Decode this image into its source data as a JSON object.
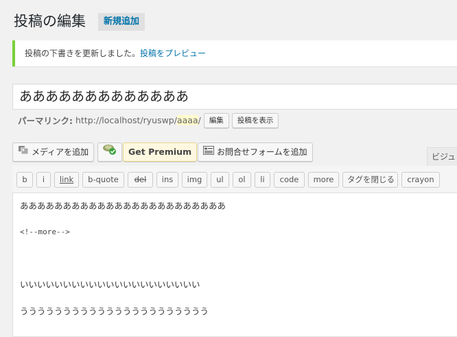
{
  "header": {
    "title": "投稿の編集",
    "add_new_label": "新規追加"
  },
  "notice": {
    "text": "投稿の下書きを更新しました。",
    "link_text": "投稿をプレビュー",
    "accent_color": "#7ad03a"
  },
  "post": {
    "title": "あああああああああああああ"
  },
  "permalink": {
    "label": "パーマリンク:",
    "url_prefix": "http://localhost/ryuswp/",
    "slug": "aaaa",
    "url_suffix": "/",
    "edit_label": "編集",
    "view_label": "投稿を表示"
  },
  "media_buttons": {
    "add_media_label": "メディアを追加",
    "get_premium_label": "Get Premium",
    "add_form_label": "お問合せフォームを追加"
  },
  "editor": {
    "visual_tab_label": "ビジュ",
    "quicktags": [
      "b",
      "i",
      "link",
      "b-quote",
      "del",
      "ins",
      "img",
      "ul",
      "ol",
      "li",
      "code",
      "more",
      "タグを閉じる",
      "crayon"
    ],
    "lines": [
      "ああああああああああああああああああああああああ",
      "<!--more-->",
      "いいいいいいいいいいいいいいいいいいいいい",
      "うううううううううううううううううううううう"
    ]
  },
  "icons": {
    "add_media": "media-icon",
    "plugin": "plugin-badge-icon",
    "form": "form-icon"
  },
  "colors": {
    "link": "#0073aa",
    "slug_highlight": "#fffbcc",
    "premium_bg": "#fff8e0"
  }
}
